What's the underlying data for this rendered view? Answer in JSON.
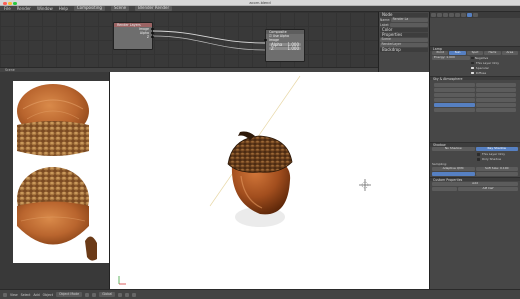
{
  "window": {
    "title": "acorn.blend"
  },
  "infobar": {
    "menus": [
      "File",
      "Render",
      "Window",
      "Help"
    ],
    "layout": "Compositing",
    "scene": "Scene",
    "engine": "Blender Render"
  },
  "node_editor": {
    "header_label": "Scene",
    "nodes": {
      "render_layers": {
        "title": "Render Layers",
        "outputs": [
          "Image",
          "Alpha",
          "Z"
        ]
      },
      "composite": {
        "title": "Composite",
        "use_alpha_label": "Use Alpha",
        "inputs": [
          "Image"
        ],
        "alpha": {
          "label": "Alpha",
          "value": "1.000"
        },
        "z": {
          "label": "Z",
          "value": "1.000"
        }
      }
    }
  },
  "node_props": {
    "node_section": "Node",
    "name_label": "Name:",
    "name_value": "Render La",
    "label_label": "Label:",
    "color_section": "Color",
    "properties_section": "Properties",
    "scene_value": "Scene",
    "layer_value": "RenderLayer",
    "backdrop_section": "Backdrop"
  },
  "properties": {
    "lamp_section": "Lamp",
    "types": [
      "Point",
      "Sun",
      "Spot",
      "Hemi",
      "Area"
    ],
    "active_type": "Sun",
    "energy_label": "Energy:",
    "energy_value": "1.000",
    "options": [
      "Negative",
      "This Layer Only",
      "Specular",
      "Diffuse"
    ],
    "sky_section": "Sky & Atmosphere",
    "shadow_section": "Shadow",
    "shadow_types": [
      "No Shadow",
      "Ray Shadow"
    ],
    "shadow_opts": [
      "This Layer Only",
      "Only Shadow"
    ],
    "sampling_label": "Sampling:",
    "adaptive": "Adaptive QMC",
    "soft_size_label": "Soft Size:",
    "soft_size_value": "0.100",
    "custom_props_section": "Custom Properties",
    "add_label": "Add",
    "api_label": "API Def"
  },
  "bottombar": {
    "view": "View",
    "select": "Select",
    "add": "Add",
    "object": "Object",
    "mode": "Object Mode",
    "pivot": "Global"
  },
  "colors": {
    "acorn_cap": "#6b3a17",
    "acorn_body": "#a85a2a",
    "accent_blue": "#5680c2"
  }
}
